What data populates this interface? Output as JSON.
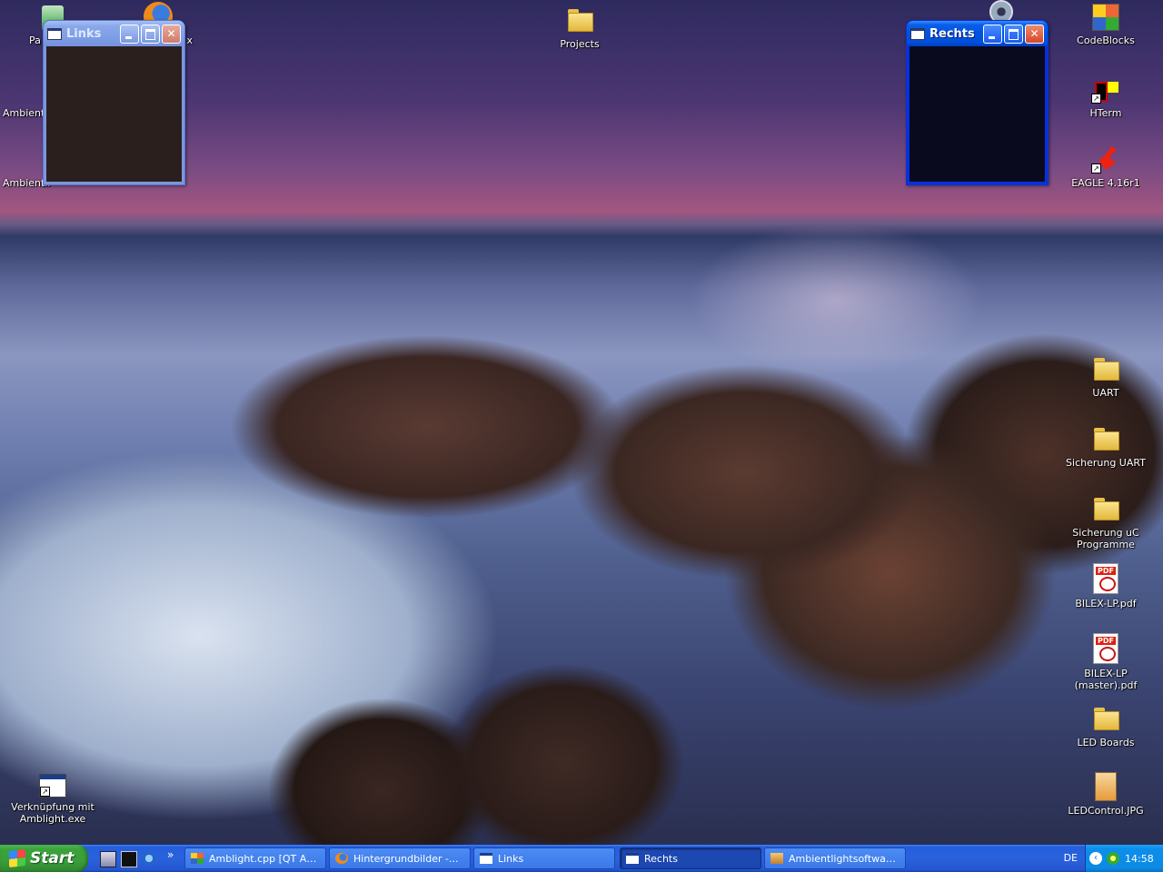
{
  "desktop": {
    "icons": {
      "projects": "Projects",
      "papierkorb": "Pa",
      "ambient1": "Ambientli",
      "ambient2": "Ambientli",
      "firefox_tail": "x",
      "codeblocks": "CodeBlocks",
      "hterm": "HTerm",
      "eagle": "EAGLE 4.16r1",
      "uart": "UART",
      "sicherung_uart": "Sicherung UART",
      "sicherung_uc": "Sicherung uC Programme",
      "bilex_lp": "BILEX-LP.pdf",
      "bilex_lp_master": "BILEX-LP (master).pdf",
      "led_boards": "LED Boards",
      "ledcontrol": "LEDControl.JPG",
      "verknuepfung": "Verknüpfung mit Amblight.exe"
    },
    "pdf_badge": "PDF",
    "pdf_badge2": "PDF"
  },
  "windows": {
    "links": {
      "title": "Links",
      "body_color": "#2b1f1e"
    },
    "rechts": {
      "title": "Rechts",
      "body_color": "#0a0a1e"
    }
  },
  "taskbar": {
    "start_label": "Start",
    "items": [
      {
        "label": "Amblight.cpp [QT Ap..."
      },
      {
        "label": "Hintergrundbilder -..."
      },
      {
        "label": "Links"
      },
      {
        "label": "Rechts"
      },
      {
        "label": "Ambientlightsoftware..."
      }
    ],
    "chevron": "»",
    "language": "DE",
    "clock": "14:58"
  },
  "colors": {
    "accent": "#0054e3",
    "start_green": "#3a9d3a",
    "taskbar_blue": "#2456d0"
  }
}
